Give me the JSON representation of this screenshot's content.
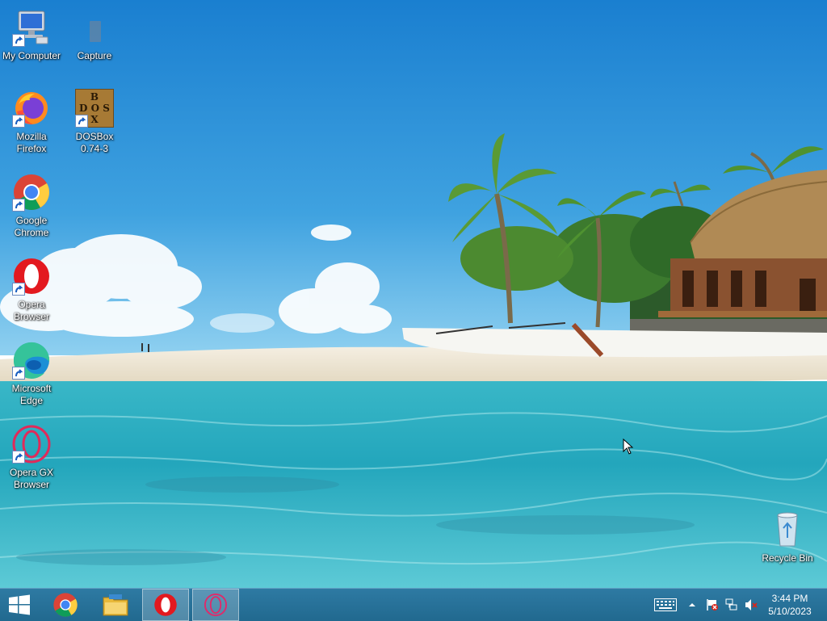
{
  "desktop": {
    "icons": [
      {
        "label": "My Computer",
        "icon": "computer-icon"
      },
      {
        "label": "Capture",
        "icon": "file-icon"
      },
      {
        "label": "Mozilla\nFirefox",
        "icon": "firefox-icon"
      },
      {
        "label": "DOSBox\n0.74-3",
        "icon": "dosbox-icon",
        "icon_text": [
          "B",
          "D O S",
          "X"
        ]
      },
      {
        "label": "Google\nChrome",
        "icon": "chrome-icon"
      },
      {
        "label": "Opera\nBrowser",
        "icon": "opera-icon"
      },
      {
        "label": "Microsoft\nEdge",
        "icon": "edge-icon"
      },
      {
        "label": "Opera GX\nBrowser",
        "icon": "opera-gx-icon"
      },
      {
        "label": "Recycle Bin",
        "icon": "recycle-bin-icon"
      }
    ]
  },
  "taskbar": {
    "buttons": [
      {
        "name": "start",
        "icon": "windows-logo-icon"
      },
      {
        "name": "chrome",
        "icon": "chrome-icon"
      },
      {
        "name": "file-explorer",
        "icon": "folder-icon"
      },
      {
        "name": "opera",
        "icon": "opera-icon",
        "active": true
      },
      {
        "name": "opera-gx",
        "icon": "opera-gx-icon",
        "active": true
      }
    ],
    "tray": {
      "icons": [
        "keyboard-icon",
        "chevron-up-icon",
        "action-center-flag-icon",
        "network-icon",
        "volume-muted-icon"
      ],
      "clock": {
        "time": "3:44 PM",
        "date": "5/10/2023"
      }
    },
    "colors": {
      "background": "#2a74a0"
    }
  }
}
